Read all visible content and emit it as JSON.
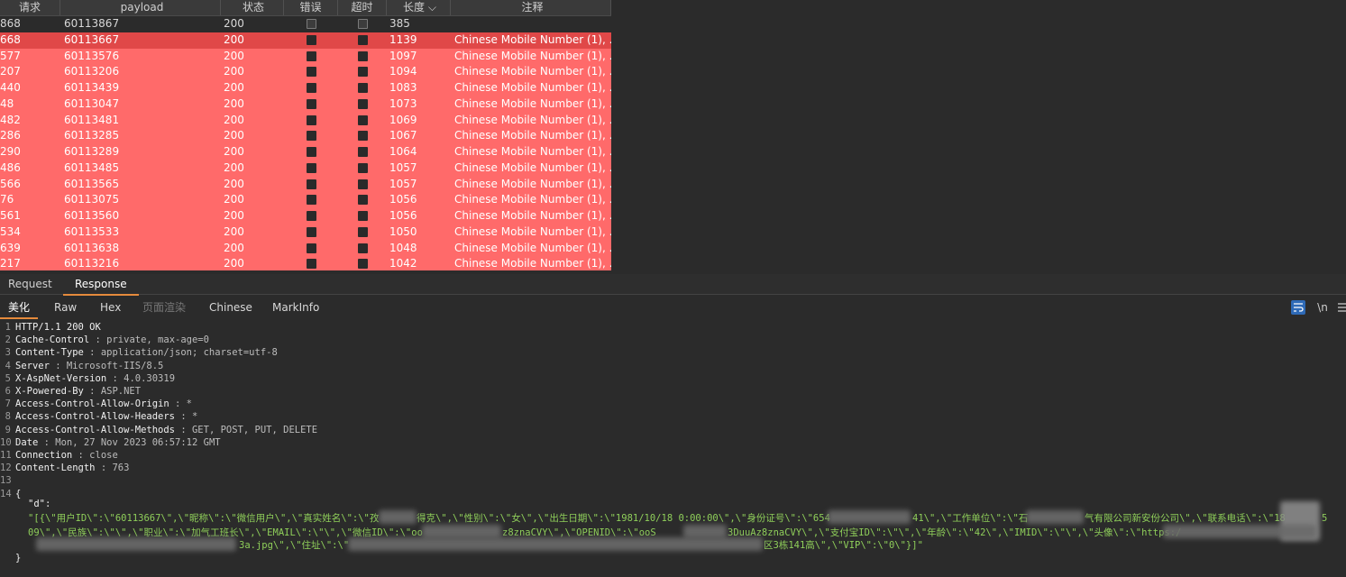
{
  "table": {
    "headers": [
      "请求",
      "payload",
      "状态",
      "错误",
      "超时",
      "长度",
      "注释"
    ],
    "sort_indicator": "⌵",
    "rows": [
      {
        "req": "868",
        "payload": "60113867",
        "status": "200",
        "length": "385",
        "note": "",
        "style": "plain"
      },
      {
        "req": "668",
        "payload": "60113667",
        "status": "200",
        "length": "1139",
        "note": "Chinese Mobile Number (1), ...",
        "style": "sel"
      },
      {
        "req": "577",
        "payload": "60113576",
        "status": "200",
        "length": "1097",
        "note": "Chinese Mobile Number (1), ...",
        "style": "hl"
      },
      {
        "req": "207",
        "payload": "60113206",
        "status": "200",
        "length": "1094",
        "note": "Chinese Mobile Number (1), ...",
        "style": "hl"
      },
      {
        "req": "440",
        "payload": "60113439",
        "status": "200",
        "length": "1083",
        "note": "Chinese Mobile Number (1), ...",
        "style": "hl"
      },
      {
        "req": "48",
        "payload": "60113047",
        "status": "200",
        "length": "1073",
        "note": "Chinese Mobile Number (1), ...",
        "style": "hl"
      },
      {
        "req": "482",
        "payload": "60113481",
        "status": "200",
        "length": "1069",
        "note": "Chinese Mobile Number (1), ...",
        "style": "hl"
      },
      {
        "req": "286",
        "payload": "60113285",
        "status": "200",
        "length": "1067",
        "note": "Chinese Mobile Number (1), ...",
        "style": "hl"
      },
      {
        "req": "290",
        "payload": "60113289",
        "status": "200",
        "length": "1064",
        "note": "Chinese Mobile Number (1), ...",
        "style": "hl"
      },
      {
        "req": "486",
        "payload": "60113485",
        "status": "200",
        "length": "1057",
        "note": "Chinese Mobile Number (1), ...",
        "style": "hl"
      },
      {
        "req": "566",
        "payload": "60113565",
        "status": "200",
        "length": "1057",
        "note": "Chinese Mobile Number (1), ...",
        "style": "hl"
      },
      {
        "req": "76",
        "payload": "60113075",
        "status": "200",
        "length": "1056",
        "note": "Chinese Mobile Number (1), ...",
        "style": "hl"
      },
      {
        "req": "561",
        "payload": "60113560",
        "status": "200",
        "length": "1056",
        "note": "Chinese Mobile Number (1), ...",
        "style": "hl"
      },
      {
        "req": "534",
        "payload": "60113533",
        "status": "200",
        "length": "1050",
        "note": "Chinese Mobile Number (1), ...",
        "style": "hl"
      },
      {
        "req": "639",
        "payload": "60113638",
        "status": "200",
        "length": "1048",
        "note": "Chinese Mobile Number (1), ...",
        "style": "hl"
      },
      {
        "req": "217",
        "payload": "60113216",
        "status": "200",
        "length": "1042",
        "note": "Chinese Mobile Number (1), ...",
        "style": "hl"
      }
    ]
  },
  "req_tabs": {
    "request": "Request",
    "response": "Response"
  },
  "view_tabs": {
    "pretty": "美化",
    "raw": "Raw",
    "hex": "Hex",
    "render": "页面渲染",
    "chinese": "Chinese",
    "markinfo": "MarkInfo"
  },
  "tools": {
    "wrap_icon": "wrap-icon",
    "newline": "\\n",
    "menu_icon": "menu-icon"
  },
  "response_lines": [
    {
      "n": "1",
      "key": "HTTP/1.1 200 OK",
      "val": ""
    },
    {
      "n": "2",
      "key": "Cache-Control",
      "val": " : private,  max-age=0"
    },
    {
      "n": "3",
      "key": "Content-Type",
      "val": " : application/json;  charset=utf-8"
    },
    {
      "n": "4",
      "key": "Server",
      "val": " : Microsoft-IIS/8.5"
    },
    {
      "n": "5",
      "key": "X-AspNet-Version",
      "val": " : 4.0.30319"
    },
    {
      "n": "6",
      "key": "X-Powered-By",
      "val": " : ASP.NET"
    },
    {
      "n": "7",
      "key": "Access-Control-Allow-Origin",
      "val": "  : *"
    },
    {
      "n": "8",
      "key": "Access-Control-Allow-Headers",
      "val": "  : *"
    },
    {
      "n": "9",
      "key": "Access-Control-Allow-Methods",
      "val": "  : GET,  POST,  PUT,  DELETE"
    },
    {
      "n": "10",
      "key": "Date",
      "val": " : Mon,  27 Nov 2023 06:57:12  GMT"
    },
    {
      "n": "11",
      "key": "Connection",
      "val": " : close"
    },
    {
      "n": "12",
      "key": "Content-Length",
      "val": " : 763"
    },
    {
      "n": "13",
      "key": "",
      "val": ""
    },
    {
      "n": "14",
      "key": "{",
      "val": ""
    }
  ],
  "body": {
    "key": "\"d\":",
    "line1": "\"[{\\\"用户ID\\\":\\\"60113667\\\",\\\"昵称\\\":\\\"微信用户\\\",\\\"真实姓名\\\":\\\"孜",
    "line1b": "得克\\\",\\\"性别\\\":\\\"女\\\",\\\"出生日期\\\":\\\"1981/10/18 0:00:00\\\",\\\"身份证号\\\":\\\"654",
    "line1c": "41\\\",\\\"工作单位\\\":\\\"石",
    "line1d": "气有限公司新安份公司\\\",\\\"联系电话\\\":\\\"18",
    "line1e": "5",
    "line2a": "09\\\",\\\"民族\\\":\\\"\\\",\\\"职业\\\":\\\"加气工班长\\\",\\\"EMAIL\\\":\\\"\\\",\\\"微信ID\\\":\\\"oo",
    "line2b": "z8znaCVY\\\",\\\"OPENID\\\":\\\"ooS",
    "line2c": "3DuuAz8znaCVY\\\",\\\"支付宝ID\\\":\\\"\\\",\\\"年龄\\\":\\\"42\\\",\\\"IMID\\\":\\\"\\\",\\\"头像\\\":\\\"https:/",
    "line3a": "3a.jpg\\\",\\\"住址\\\":\\\"",
    "line3b": "区3栋141高\\\",\\\"VIP\\\":\\\"0\\\"}]\"",
    "close": "}",
    "close_ln": ""
  }
}
